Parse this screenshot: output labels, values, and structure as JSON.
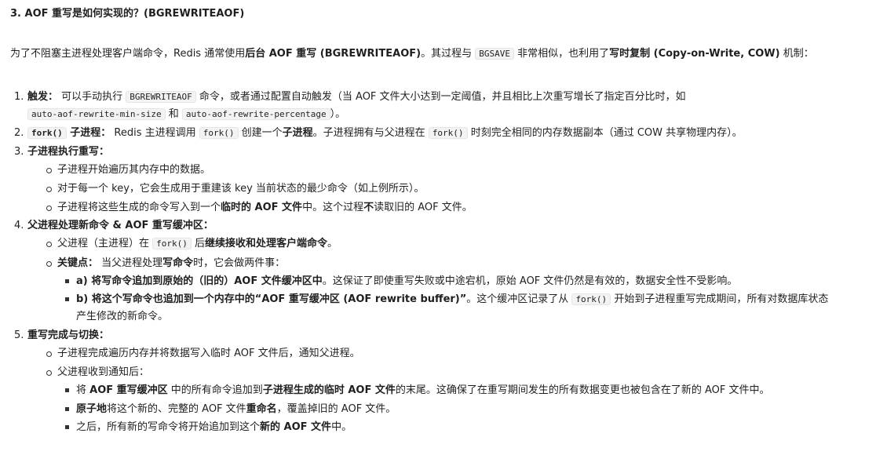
{
  "heading": "3. AOF 重写是如何实现的？(BGREWRITEAOF)",
  "intro": {
    "p1": "为了不阻塞主进程处理客户端命令，Redis 通常使用",
    "b1": "后台 AOF 重写 (BGREWRITEAOF)",
    "p2": "。其过程与 ",
    "code1": "BGSAVE",
    "p3": " 非常相似，也利用了",
    "b2": "写时复制 (Copy-on-Write, COW)",
    "p4": " 机制："
  },
  "steps": [
    {
      "num": "1.",
      "title": "触发：",
      "t1": " 可以手动执行 ",
      "code1": "BGREWRITEAOF",
      "t2": " 命令，或者通过配置自动触发（当 AOF 文件大小达到一定阈值，并且相比上次重写增长了指定百分比时，如",
      "code2": "auto-aof-rewrite-min-size",
      "t3": " 和 ",
      "code3": "auto-aof-rewrite-percentage",
      "t4": "）。"
    },
    {
      "num": "2.",
      "code0": "fork()",
      "title": " 子进程：",
      "t1": " Redis 主进程调用 ",
      "code1": "fork()",
      "t2": " 创建一个",
      "b1": "子进程",
      "t3": "。子进程拥有与父进程在 ",
      "code2": "fork()",
      "t4": " 时刻完全相同的内存数据副本（通过 COW 共享物理内存）。"
    },
    {
      "num": "3.",
      "title": "子进程执行重写：",
      "subs": [
        {
          "t": "子进程开始遍历其内存中的数据。"
        },
        {
          "t": "对于每一个 key，它会生成用于重建该 key 当前状态的最少命令（如上例所示）。"
        },
        {
          "t1": "子进程将这些生成的命令写入到一个",
          "b1": "临时的 AOF 文件",
          "t2": "中。这个过程",
          "b2": "不",
          "t3": "读取旧的 AOF 文件。"
        }
      ]
    },
    {
      "num": "4.",
      "title": "父进程处理新命令 & AOF 重写缓冲区：",
      "sub1": {
        "t1": "父进程（主进程）在 ",
        "code1": "fork()",
        "t2": " 后",
        "b1": "继续接收和处理客户端命令",
        "t3": "。"
      },
      "sub2": {
        "b0": "关键点：",
        "t1": " 当父进程处理",
        "b1": "写命令",
        "t2": "时，它会做两件事："
      },
      "subsub": [
        {
          "b1": "a) 将写命令追加到原始的（旧的）AOF 文件缓冲区中",
          "t1": "。这保证了即使重写失败或中途宕机，原始 AOF 文件仍然是有效的，数据安全性不受影响。"
        },
        {
          "b1": "b) 将这个写命令也追加到一个内存中的“AOF 重写缓冲区 (AOF rewrite buffer)”",
          "t1": "。这个缓冲区记录了从 ",
          "code1": "fork()",
          "t2": " 开始到子进程重写完成期间，所有对数据库状态产生修改的新命令。"
        }
      ]
    },
    {
      "num": "5.",
      "title": "重写完成与切换：",
      "sub1": {
        "t": "子进程完成遍历内存并将数据写入临时 AOF 文件后，通知父进程。"
      },
      "sub2": {
        "t": "父进程收到通知后："
      },
      "subsub": [
        {
          "t0": "将 ",
          "b1": "AOF 重写缓冲区",
          "t1": " 中的所有命令追加到",
          "b2": "子进程生成的临时 AOF 文件",
          "t2": "的末尾。这确保了在重写期间发生的所有数据变更也被包含在了新的 AOF 文件中。"
        },
        {
          "b1": "原子地",
          "t1": "将这个新的、完整的 AOF 文件",
          "b2": "重命名",
          "t2": "，覆盖掉旧的 AOF 文件。"
        },
        {
          "t1": "之后，所有新的写命令将开始追加到这个",
          "b1": "新的 AOF 文件",
          "t2": "中。"
        }
      ]
    }
  ]
}
